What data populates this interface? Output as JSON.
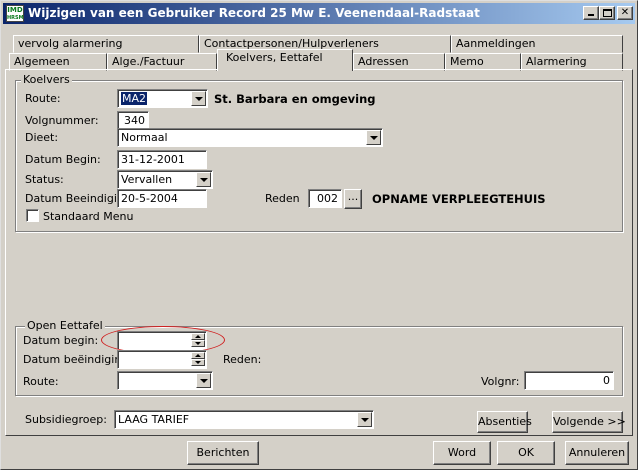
{
  "window": {
    "title": "Wijzigen van een Gebruiker Record 25 Mw E. Veenendaal-Radstaat",
    "icon_text_top": "IMD",
    "icon_text_bottom": "HRSM"
  },
  "tabs_row1": [
    "vervolg alarmering",
    "Contactpersonen/Hulpverleners",
    "Aanmeldingen"
  ],
  "tabs_row2": [
    "Algemeen",
    "Alge./Factuur",
    "Koelvers, Eettafel",
    "Adressen",
    "Memo",
    "Alarmering"
  ],
  "koelvers": {
    "legend": "Koelvers",
    "route_label": "Route:",
    "route_value": "MA2",
    "route_desc": "St. Barbara en omgeving",
    "volgnummer_label": "Volgnummer:",
    "volgnummer_value": "340",
    "dieet_label": "Dieet:",
    "dieet_value": "Normaal",
    "datum_begin_label": "Datum Begin:",
    "datum_begin_value": "31-12-2001",
    "status_label": "Status:",
    "status_value": "Vervallen",
    "datum_beeindiging_label": "Datum Beeindiging:",
    "datum_beeindiging_value": "20-5-2004",
    "reden_label": "Reden",
    "reden_code": "002",
    "reden_btn": "...",
    "reden_desc": "OPNAME VERPLEEGTEHUIS",
    "standaard_menu_label": "Standaard Menu"
  },
  "open_eettafel": {
    "legend": "Open Eettafel",
    "datum_begin_label": "Datum begin:",
    "datum_begin_value": "",
    "datum_beeindiging_label": "Datum beëindiging:",
    "reden_label": "Reden:",
    "route_label": "Route:",
    "volgnr_label": "Volgnr:",
    "volgnr_value": "0"
  },
  "subsidiegroep": {
    "label": "Subsidiegroep:",
    "value": "LAAG TARIEF"
  },
  "buttons": {
    "absenties": "Absenties",
    "volgende": "Volgende >>",
    "berichten": "Berichten",
    "word": "Word",
    "ok": "OK",
    "annuleren": "Annuleren"
  }
}
